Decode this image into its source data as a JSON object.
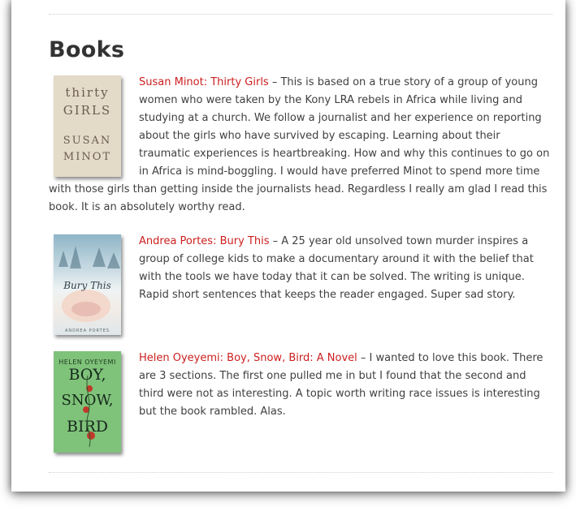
{
  "page": {
    "heading": "Books"
  },
  "books": [
    {
      "link": "Susan Minot: Thirty Girls",
      "sep": " – ",
      "text": "This is based on a true story of a group of young women who were taken by the Kony LRA rebels in Africa while living and studying at a church. We follow a journalist and her experience on reporting about the girls who have survived by escaping. Learning about their traumatic experiences is heartbreaking. How and why this continues to go on in Africa is mind-boggling. I would have preferred Minot to spend more time with those girls than getting inside the journalists head. Regardless I really am glad I read this book. It is an absolutely worthy read.",
      "cover": {
        "line1": "thirty",
        "line2": "GIRLS",
        "line3": "SUSAN",
        "line4": "MINOT"
      }
    },
    {
      "link": "Andrea Portes: Bury This",
      "sep": " – ",
      "text": "A 25 year old unsolved town murder inspires a group of college kids to make a documentary around it with the belief that with the tools we have today that it can be solved. The writing is unique. Rapid short sentences that keeps the reader engaged. Super sad story.",
      "cover": {
        "title": "Bury This",
        "author": "ANDREA PORTES"
      }
    },
    {
      "link": "Helen Oyeyemi: Boy, Snow, Bird: A Novel",
      "sep": " – ",
      "text": "I wanted to love this book. There are 3 sections. The first one pulled me in but I found that the second and third were not as interesting. A topic worth writing race issues is interesting but the book rambled. Alas.",
      "cover": {
        "author": "HELEN OYEYEMI",
        "line1": "BOY,",
        "line2": "SNOW,",
        "line3": "BIRD"
      }
    }
  ],
  "colors": {
    "link": "#cc1f1f",
    "text": "#404040",
    "heading": "#333333"
  }
}
